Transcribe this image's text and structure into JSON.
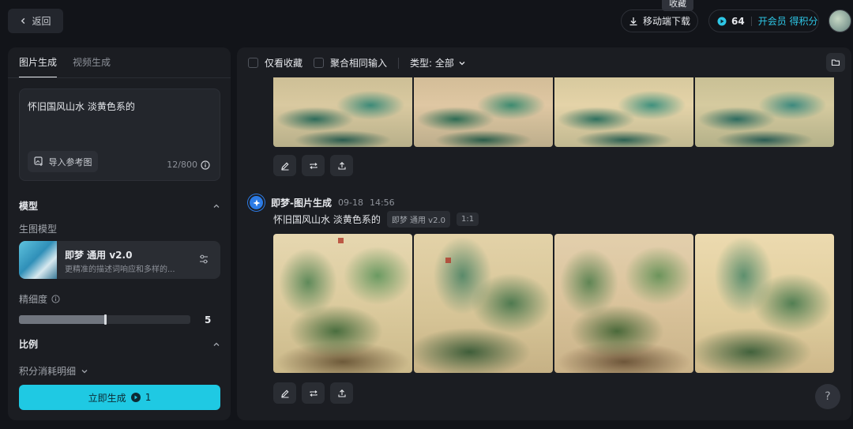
{
  "topbar": {
    "back_label": "返回",
    "tooltip": "收藏",
    "download_label": "移动端下载",
    "points": "64",
    "vip_label": "开会员 得积分"
  },
  "left_panel": {
    "tabs": [
      {
        "label": "图片生成",
        "active": true
      },
      {
        "label": "视频生成",
        "active": false
      }
    ],
    "prompt": {
      "text": "怀旧国风山水 淡黄色系的",
      "ref_button": "导入参考图",
      "char_count": "12/800"
    },
    "model": {
      "section_title": "模型",
      "sub_label": "生图模型",
      "name": "即梦 通用 v2.0",
      "desc": "更精准的描述词响应和多样的..."
    },
    "detail": {
      "label": "精细度",
      "value": "5",
      "level_fraction": 0.5
    },
    "ratio": {
      "section_title": "比例"
    },
    "cost_label": "积分消耗明细",
    "generate_label": "立即生成",
    "generate_cost": "1"
  },
  "right_panel": {
    "filters": {
      "favorites_only": "仅看收藏",
      "merge_inputs": "聚合相同输入",
      "type_label": "类型: 全部"
    },
    "record": {
      "title": "即梦-图片生成",
      "date": "09-18",
      "time": "14:56",
      "prompt": "怀旧国风山水 淡黄色系的",
      "model_tag": "即梦 通用 v2.0",
      "ratio_tag": "1:1"
    }
  },
  "help_label": "?",
  "colors": {
    "accent": "#1fc9e3",
    "background": "#121419",
    "panel": "#1b1d22"
  }
}
